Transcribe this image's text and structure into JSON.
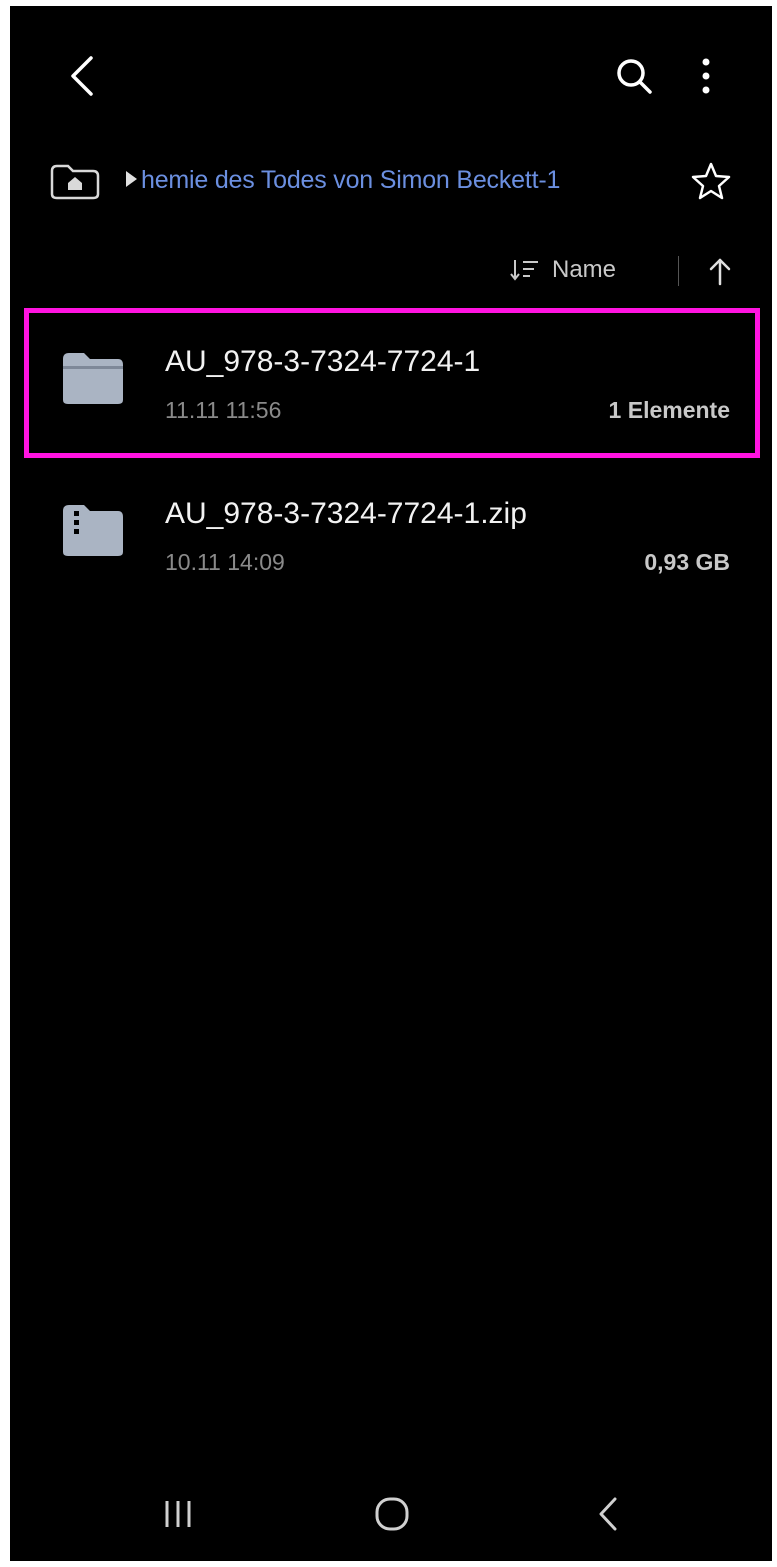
{
  "app": {
    "icons": {
      "back": "chevron-left-icon",
      "search": "search-icon",
      "more": "more-vertical-icon",
      "home": "home-folder-icon",
      "favorite": "star-icon",
      "sort": "sort-icon",
      "sort_direction": "arrow-up-icon"
    }
  },
  "breadcrumb": {
    "path_label": "hemie des Todes von Simon Beckett-1"
  },
  "sort": {
    "label": "Name",
    "direction": "ascending"
  },
  "files": [
    {
      "name": "AU_978-3-7324-7724-1",
      "date": "11.11 11:56",
      "meta": "1 Elemente",
      "type": "folder",
      "selected": true
    },
    {
      "name": "AU_978-3-7324-7724-1.zip",
      "date": "10.11 14:09",
      "meta": "0,93 GB",
      "type": "zip",
      "selected": false
    }
  ],
  "colors": {
    "background": "#000000",
    "accent": "#6b8fe0",
    "selection_outline": "#ff14e0",
    "folder_icon": "#aab4c3"
  }
}
